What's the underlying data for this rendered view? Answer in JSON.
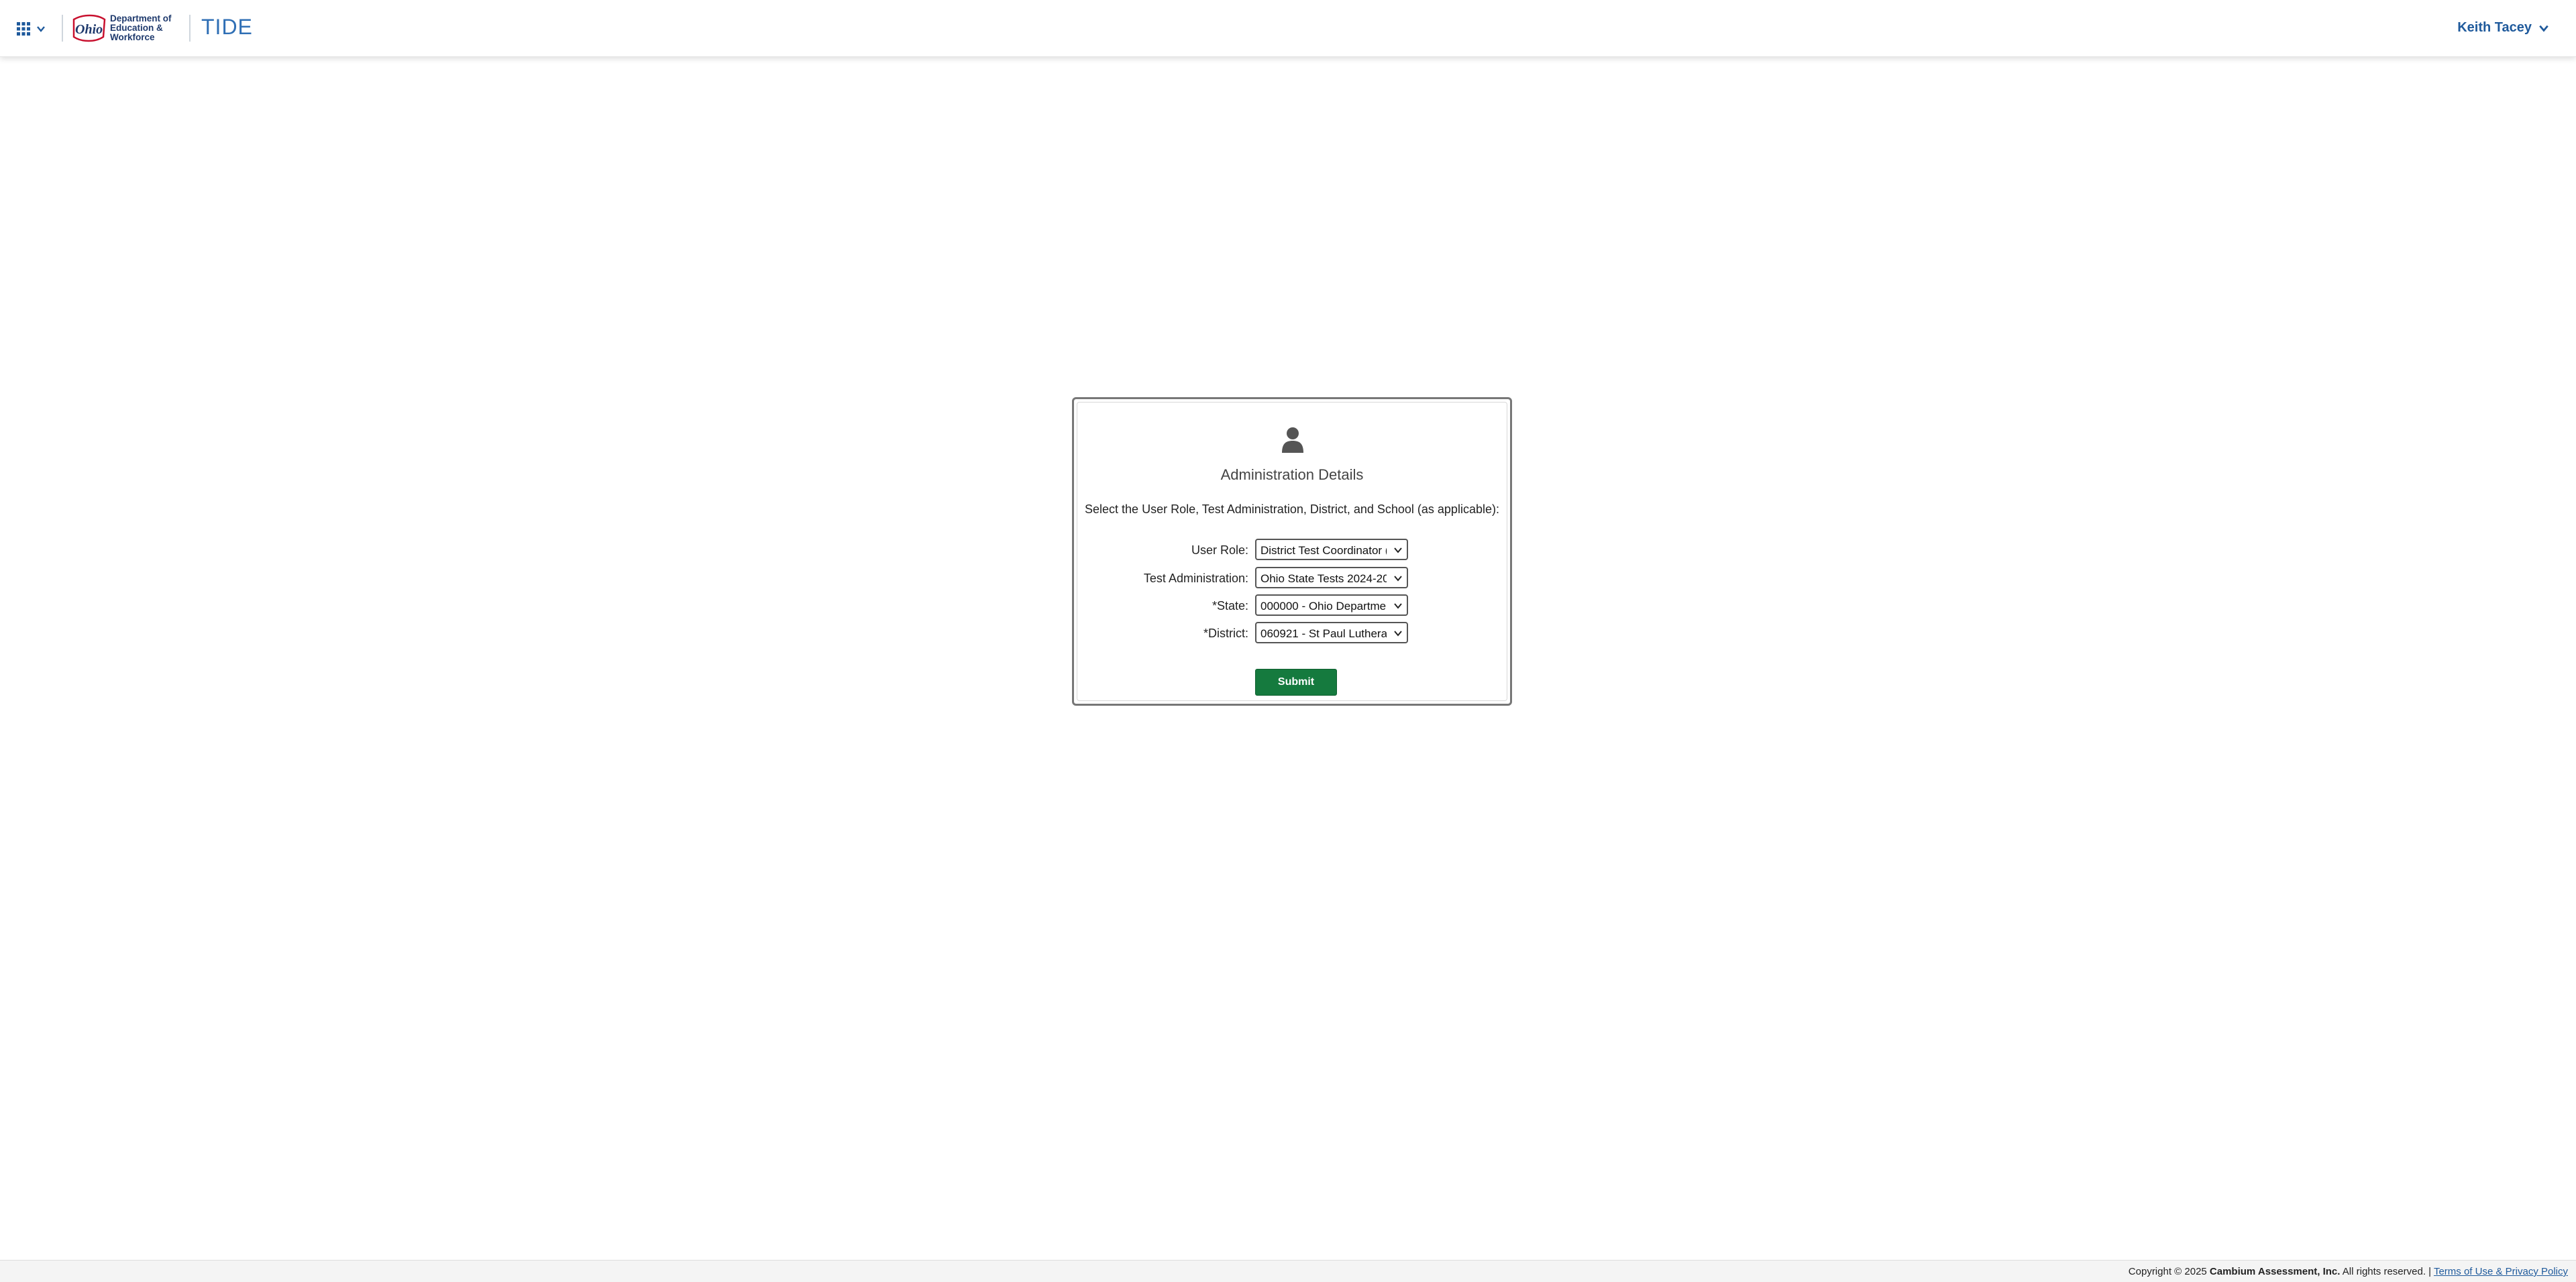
{
  "header": {
    "apps_menu_icon": "grid-icon",
    "logo_text": "Department of\nEducation &\nWorkforce",
    "logo_script": "Ohio",
    "app_name": "TIDE",
    "user_name": "Keith Tacey"
  },
  "admin": {
    "icon": "user-icon",
    "title": "Administration Details",
    "instructions": "Select the User Role, Test Administration, District, and School (as applicable):",
    "fields": [
      {
        "label": "User Role:",
        "value": "District Test Coordinator ("
      },
      {
        "label": "Test Administration:",
        "value": "Ohio State Tests 2024-20"
      },
      {
        "label": "*State:",
        "value": "000000 - Ohio Departmen"
      },
      {
        "label": "*District:",
        "value": "060921 - St Paul Luthera"
      }
    ],
    "submit_label": "Submit"
  },
  "footer": {
    "copyright_prefix": "Copyright © 2025 ",
    "company": "Cambium Assessment, Inc.",
    "rights": " All rights reserved. | ",
    "link_label": "Terms of Use & Privacy Policy"
  },
  "colors": {
    "brand_blue": "#1f5a9c",
    "submit_green": "#157a3e"
  }
}
